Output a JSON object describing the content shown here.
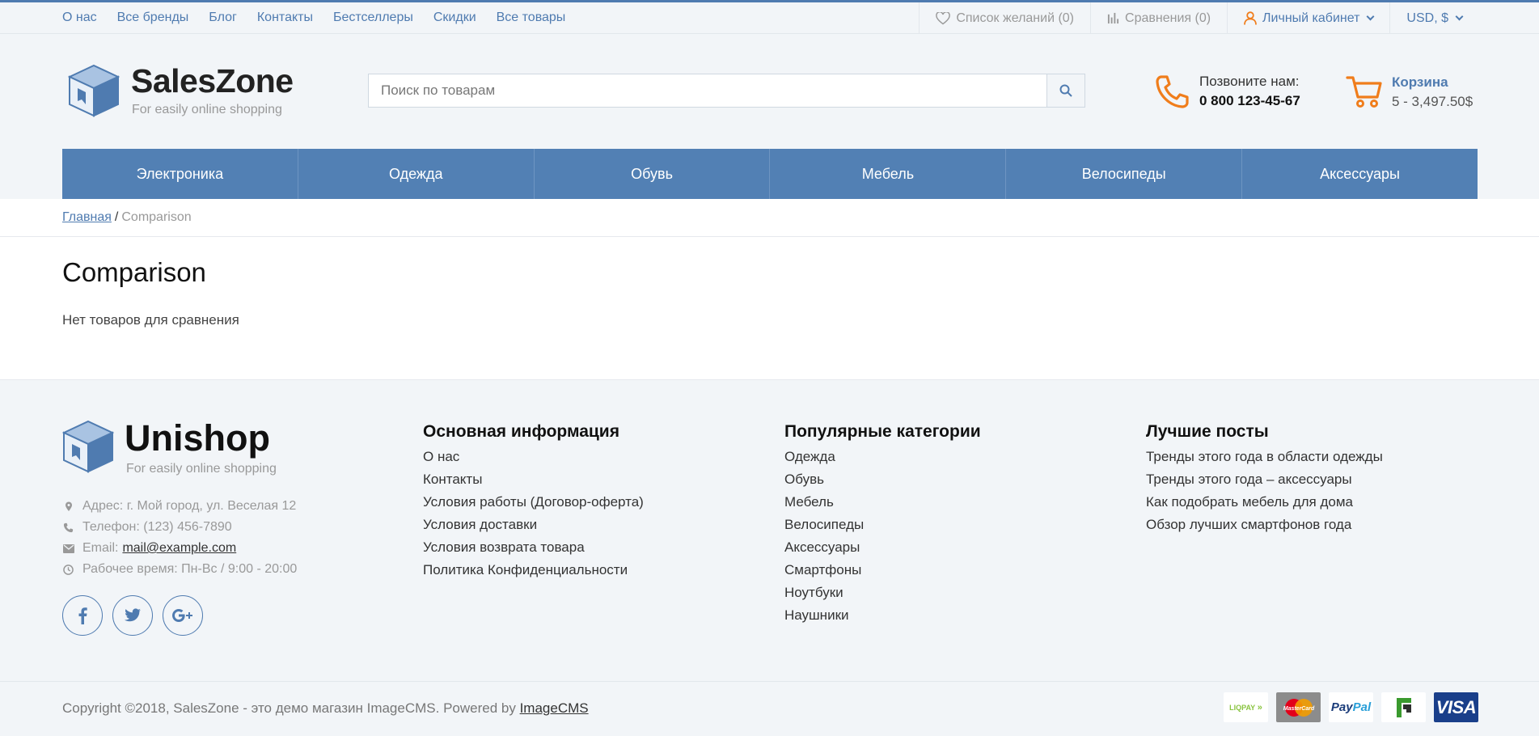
{
  "topbar": {
    "nav": [
      "О нас",
      "Все бренды",
      "Блог",
      "Контакты",
      "Бестселлеры",
      "Скидки",
      "Все товары"
    ],
    "wishlist": "Список желаний (0)",
    "compare": "Сравнения (0)",
    "account": "Личный кабинет",
    "currency": "USD, $"
  },
  "header": {
    "logo_name": "SalesZone",
    "logo_tagline": "For easily online shopping",
    "search_placeholder": "Поиск по товарам",
    "phone_label": "Позвоните нам:",
    "phone_number": "0 800 123-45-67",
    "cart_label": "Корзина",
    "cart_summary": "5 - 3,497.50$"
  },
  "categories": [
    "Электроника",
    "Одежда",
    "Обувь",
    "Мебель",
    "Велосипеды",
    "Аксессуары"
  ],
  "breadcrumb": {
    "home": "Главная",
    "separator": "/",
    "current": "Comparison"
  },
  "main": {
    "title": "Comparison",
    "empty_text": "Нет товаров для сравнения"
  },
  "footer": {
    "logo_name": "Unishop",
    "logo_tagline": "For easily online shopping",
    "address": "Адрес:  г. Мой город, ул. Веселая 12",
    "phone": "Телефон:  (123) 456-7890",
    "email_label": "Email:",
    "email": "mail@example.com",
    "hours": "Рабочее время:  Пн-Вс / 9:00 - 20:00",
    "columns": [
      {
        "title": "Основная информация",
        "links": [
          "О нас",
          "Контакты",
          "Условия работы (Договор-оферта)",
          "Условия доставки",
          "Условия возврата товара",
          "Политика Конфиденциальности"
        ]
      },
      {
        "title": "Популярные категории",
        "links": [
          "Одежда",
          "Обувь",
          "Мебель",
          "Велосипеды",
          "Аксессуары",
          "Смартфоны",
          "Ноутбуки",
          "Наушники"
        ]
      },
      {
        "title": "Лучшие посты",
        "links": [
          "Тренды этого года в области одежды",
          "Тренды этого года – аксессуары",
          "Как подобрать мебель для дома",
          "Обзор лучших смартфонов года"
        ]
      }
    ],
    "copyright": "Copyright ©2018, SalesZone - это демо магазин ImageCMS. Powered by ",
    "powered_link": "ImageCMS",
    "payments": {
      "liqpay": "LIQPAY",
      "mastercard": "MasterCard",
      "paypal_pay": "Pay",
      "paypal_pal": "Pal",
      "visa": "VISA"
    }
  },
  "colors": {
    "accent": "#4f7bb0",
    "nav_bg": "#5280b4",
    "orange": "#f07d1b",
    "panel_bg": "#f2f5f8"
  }
}
